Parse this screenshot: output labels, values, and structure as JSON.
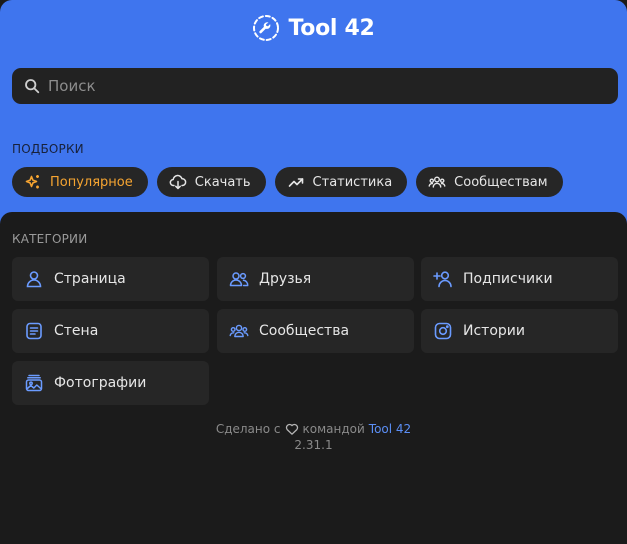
{
  "brand": {
    "name": "Tool 42",
    "logo_icon": "tool-42-logo-icon"
  },
  "search": {
    "icon": "search-icon",
    "placeholder": "Поиск",
    "value": ""
  },
  "collections": {
    "title": "ПОДБОРКИ",
    "chips": [
      {
        "label": "Популярное",
        "icon": "sparkle-icon",
        "active": true
      },
      {
        "label": "Скачать",
        "icon": "cloud-download-icon",
        "active": false
      },
      {
        "label": "Статистика",
        "icon": "trending-up-icon",
        "active": false
      },
      {
        "label": "Сообществам",
        "icon": "users-group-icon",
        "active": false
      }
    ]
  },
  "categories": {
    "title": "КАТЕГОРИИ",
    "items": [
      {
        "label": "Страница",
        "icon": "user-icon"
      },
      {
        "label": "Друзья",
        "icon": "users-icon"
      },
      {
        "label": "Подписчики",
        "icon": "user-plus-icon"
      },
      {
        "label": "Стена",
        "icon": "note-icon"
      },
      {
        "label": "Сообщества",
        "icon": "users-group-icon"
      },
      {
        "label": "Истории",
        "icon": "instagram-icon"
      },
      {
        "label": "Фотографии",
        "icon": "photos-icon"
      }
    ]
  },
  "footer": {
    "made_with": "Сделано с",
    "icon": "heart-icon",
    "by_team": "командой",
    "team_link": "Tool 42",
    "version": "2.31.1"
  },
  "colors": {
    "header_bg": "#3f75ee",
    "page_bg": "#1b1b1b",
    "surface": "#262626",
    "accent_icon": "#6b9bff",
    "active_chip_text": "#f7a531",
    "link": "#5b8ef5"
  }
}
